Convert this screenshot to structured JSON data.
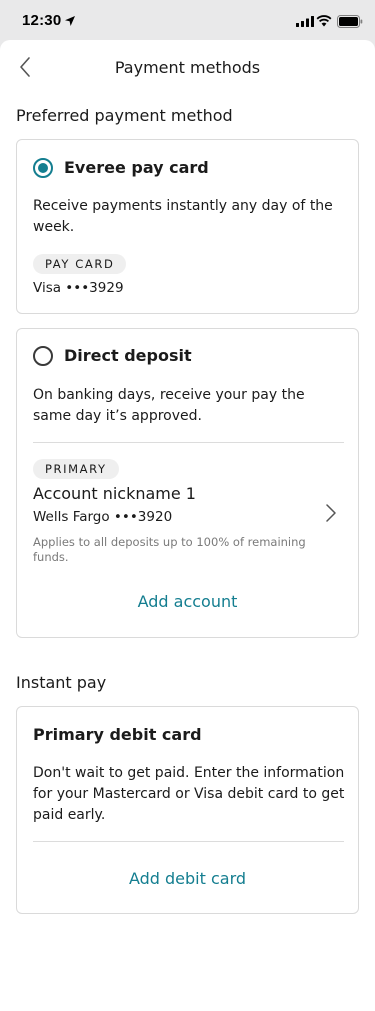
{
  "status_bar": {
    "time": "12:30",
    "icons": [
      "location-arrow-icon",
      "signal-icon",
      "wifi-icon",
      "battery-icon"
    ]
  },
  "header": {
    "title": "Payment methods",
    "back_icon": "chevron-left-icon"
  },
  "preferred": {
    "section_title": "Preferred payment method",
    "pay_card": {
      "title": "Everee pay card",
      "selected": true,
      "description": "Receive payments instantly any day of the week.",
      "tag": "PAY CARD",
      "card_number": "Visa •••3929"
    },
    "direct_deposit": {
      "title": "Direct deposit",
      "selected": false,
      "description": "On banking days, receive your pay the same day it’s approved.",
      "tag": "PRIMARY",
      "account_nickname": "Account nickname 1",
      "account_detail": "Wells Fargo •••3920",
      "note": "Applies to all deposits up to 100% of remaining funds.",
      "add_button": "Add account"
    }
  },
  "instant_pay": {
    "section_title": "Instant pay",
    "card_title": "Primary debit card",
    "description": "Don't wait to get paid. Enter the information for your Mastercard or Visa debit card to get paid early.",
    "add_button": "Add debit card"
  },
  "colors": {
    "accent": "#147e90",
    "text": "#1b1b1b",
    "muted": "#7a7a7a",
    "border": "#dadada",
    "tag_bg": "#efefef"
  }
}
